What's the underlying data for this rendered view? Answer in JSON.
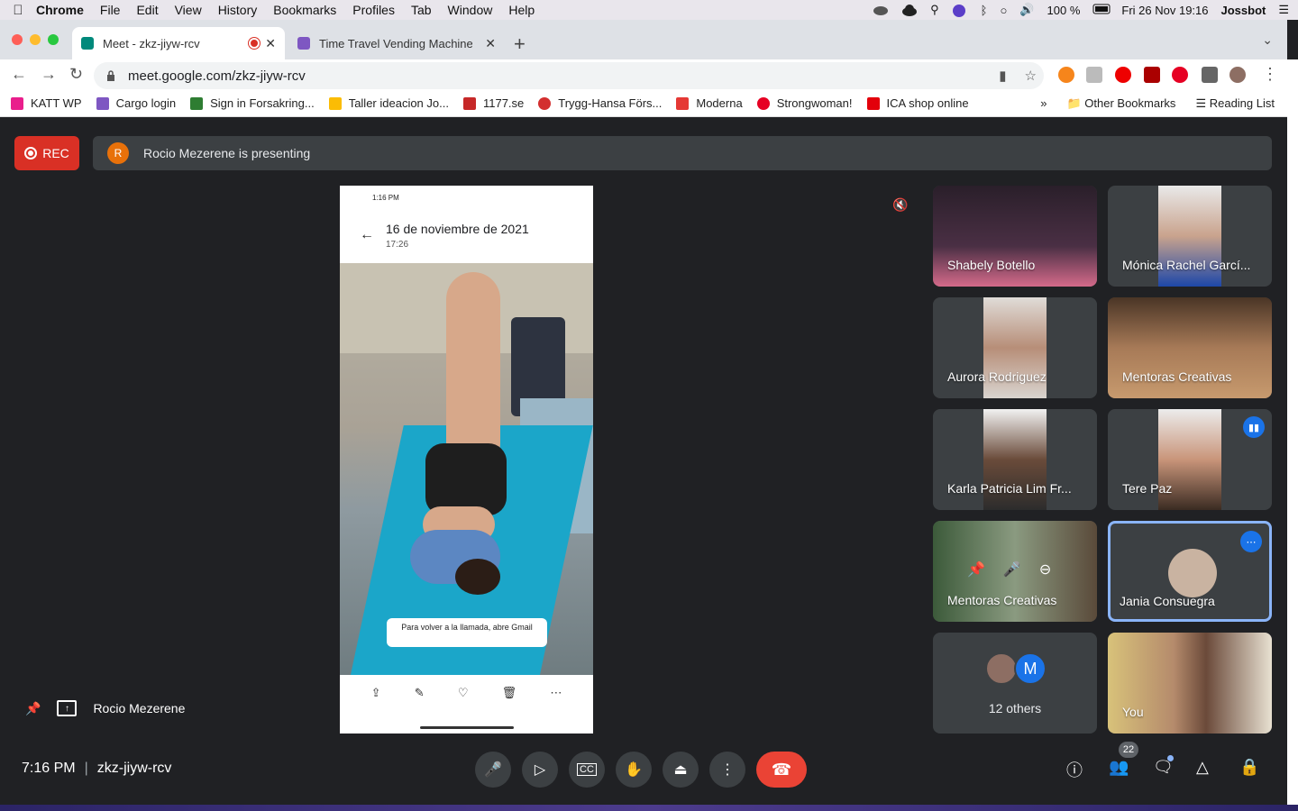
{
  "menubar": {
    "app": "Chrome",
    "items": [
      "File",
      "Edit",
      "View",
      "History",
      "Bookmarks",
      "Profiles",
      "Tab",
      "Window",
      "Help"
    ],
    "battery": "100 %",
    "datetime": "Fri 26 Nov  19:16",
    "user": "Jossbot"
  },
  "tabs": [
    {
      "title": "Meet - zkz-jiyw-rcv",
      "active": true,
      "recording": true
    },
    {
      "title": "Time Travel Vending Machine -",
      "active": false
    }
  ],
  "address": {
    "url": "meet.google.com/zkz-jiyw-rcv"
  },
  "bookmarks": [
    {
      "label": "KATT WP",
      "color": "#e91e8c"
    },
    {
      "label": "Cargo login",
      "color": "#7e57c2"
    },
    {
      "label": "Sign in Forsakring...",
      "color": "#2e7d32"
    },
    {
      "label": "Taller ideacion Jo...",
      "color": "#fbbc04"
    },
    {
      "label": "1177.se",
      "color": "#c62828"
    },
    {
      "label": "Trygg-Hansa Förs...",
      "color": "#d32f2f"
    },
    {
      "label": "Moderna",
      "color": "#e53935"
    },
    {
      "label": "Strongwoman!",
      "color": "#e60023"
    },
    {
      "label": "ICA shop online",
      "color": "#e3000b"
    }
  ],
  "bookmarks_right": {
    "more": "»",
    "other": "Other Bookmarks",
    "reading": "Reading List"
  },
  "meet": {
    "rec_label": "REC",
    "presenting_initial": "R",
    "presenting_text": "Rocio Mezerene is presenting",
    "presenter_name": "Rocio Mezerene",
    "clock": "7:16 PM",
    "separator": "|",
    "code": "zkz-jiyw-rcv",
    "participant_count": "22"
  },
  "phone": {
    "status_time": "1:16 PM",
    "date": "16 de noviembre de 2021",
    "time": "17:26",
    "toast": "Para volver a la llamada, abre Gmail"
  },
  "participants": [
    {
      "name": "Shabely Botello"
    },
    {
      "name": "Mónica Rachel Garcí..."
    },
    {
      "name": "Aurora Rodriguez"
    },
    {
      "name": "Mentoras Creativas"
    },
    {
      "name": "Karla Patricia Lim Fr..."
    },
    {
      "name": "Tere Paz"
    },
    {
      "name": "Mentoras Creativas"
    },
    {
      "name": "Jania Consuegra"
    },
    {
      "name": "12 others",
      "avatar_letter": "M"
    },
    {
      "name": "You"
    }
  ],
  "colors": {
    "accent": "#1a73e8",
    "end_call": "#ea4335",
    "rec": "#d93025",
    "bg": "#202124",
    "tile": "#3c4043"
  }
}
